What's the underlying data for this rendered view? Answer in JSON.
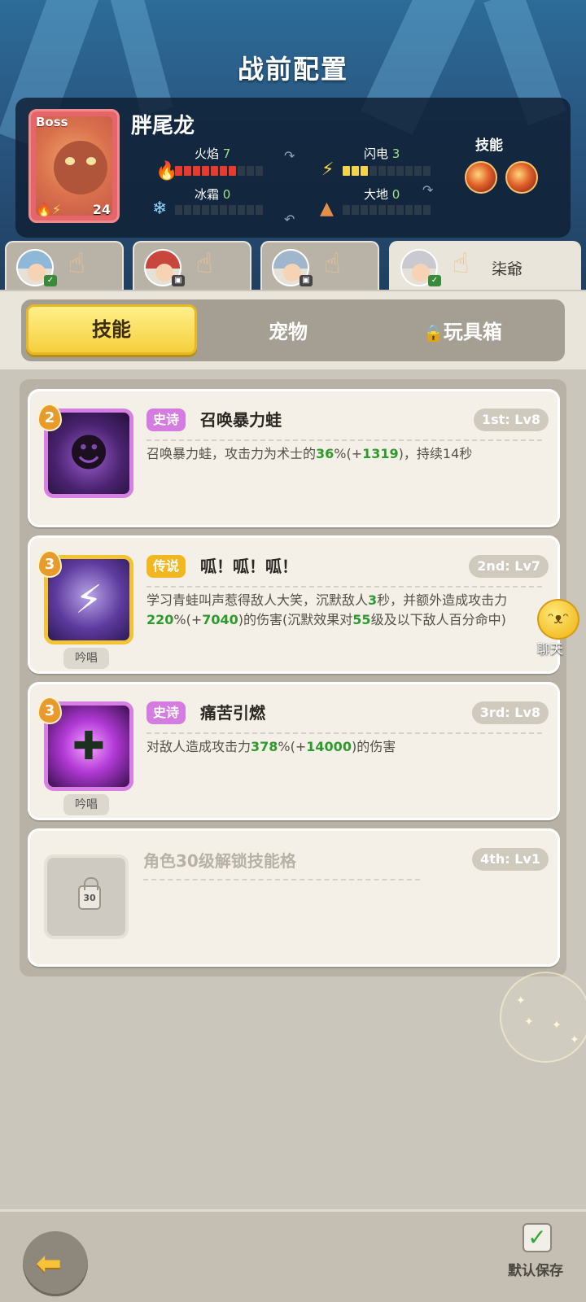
{
  "header": {
    "title": "战前配置"
  },
  "boss": {
    "tag": "Boss",
    "level": "24",
    "name": "胖尾龙",
    "elements": {
      "fire": {
        "label": "火焰",
        "value": "7",
        "fill": 7,
        "max": 10
      },
      "lightning": {
        "label": "闪电",
        "value": "3",
        "fill": 3,
        "max": 10
      },
      "frost": {
        "label": "冰霜",
        "value": "0",
        "fill": 0,
        "max": 10
      },
      "earth": {
        "label": "大地",
        "value": "0",
        "fill": 0,
        "max": 10
      }
    },
    "skills_label": "技能",
    "skill_icons": [
      "fire-orb-icon",
      "fire-ring-icon"
    ]
  },
  "heroes": [
    {
      "avatar": "hero-1-avatar",
      "name": ""
    },
    {
      "avatar": "hero-2-avatar",
      "name": ""
    },
    {
      "avatar": "hero-3-avatar",
      "name": ""
    },
    {
      "avatar": "hero-4-avatar",
      "name": "柒爺"
    }
  ],
  "tabs": {
    "skills": "技能",
    "pets": "宠物",
    "toybox": "玩具箱"
  },
  "skills": [
    {
      "level": "2",
      "rarity": "史诗",
      "name": "召唤暴力蛙",
      "slot": "1st: Lv8",
      "desc_parts": [
        "召唤暴力蛙，攻击力为术士的",
        "36",
        "%(+",
        "1319",
        ")，持续14秒"
      ]
    },
    {
      "level": "3",
      "rarity": "传说",
      "name": "呱！呱！呱！",
      "slot": "2nd: Lv7",
      "chant": "吟唱",
      "desc_parts": [
        "学习青蛙叫声惹得敌人大笑，沉默敌人",
        "3",
        "秒，并额外造成攻击力",
        "220",
        "%(+",
        "7040",
        ")的伤害(沉默效果对",
        "55",
        "级及以下敌人百分命中)"
      ]
    },
    {
      "level": "3",
      "rarity": "史诗",
      "name": "痛苦引燃",
      "slot": "3rd: Lv8",
      "chant": "吟唱",
      "desc_parts": [
        "对敌人造成攻击力",
        "378",
        "%(+",
        "14000",
        ")的伤害"
      ]
    },
    {
      "locked_title": "角色30级解锁技能格",
      "lock_level": "30",
      "slot": "4th: Lv1"
    }
  ],
  "chat": {
    "label": "聊天"
  },
  "footer": {
    "save_label": "默认保存"
  }
}
